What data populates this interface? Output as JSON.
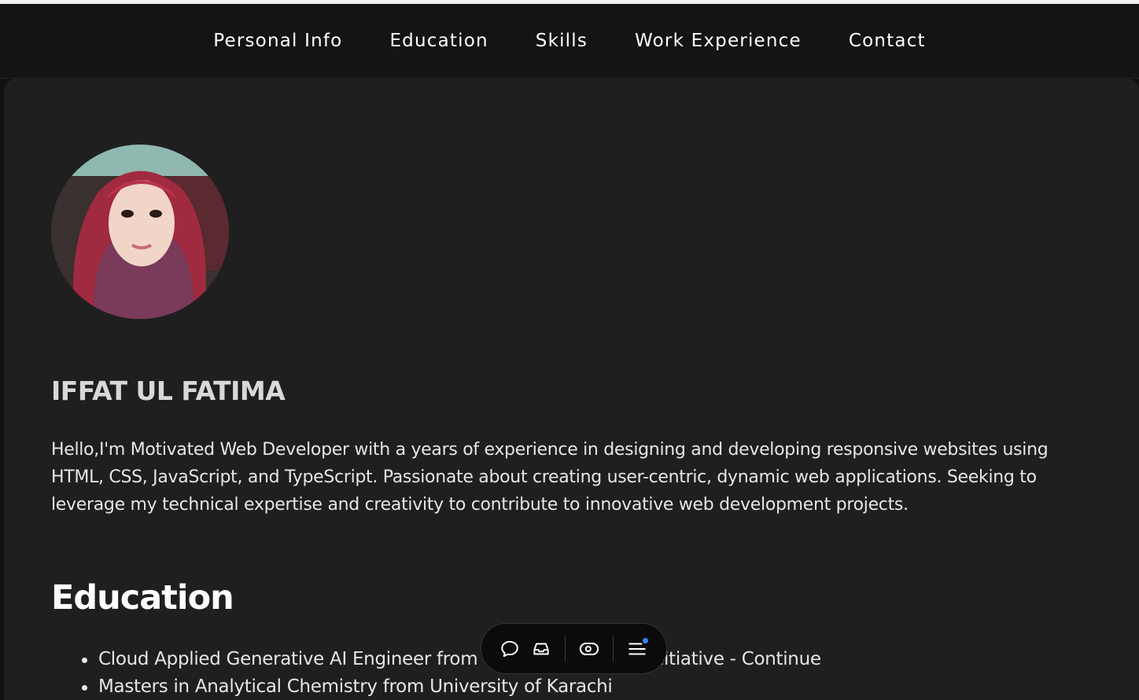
{
  "nav": {
    "items": [
      {
        "label": "Personal Info"
      },
      {
        "label": "Education"
      },
      {
        "label": "Skills"
      },
      {
        "label": "Work Experience"
      },
      {
        "label": "Contact"
      }
    ]
  },
  "profile": {
    "name": "IFFAT UL FATIMA",
    "bio": "Hello,I'm Motivated Web Developer with a years of experience in designing and developing responsive websites using HTML, CSS, JavaScript, and TypeScript. Passionate about creating user-centric, dynamic web applications. Seeking to leverage my technical expertise and creativity to contribute to innovative web development projects."
  },
  "education": {
    "title": "Education",
    "items": [
      {
        "text": "Cloud Applied Generative AI Engineer from Governor Sindh IT Initiative - Continue"
      },
      {
        "text": "Masters in Analytical Chemistry from University of Karachi"
      }
    ]
  },
  "toolbar": {
    "icons": [
      "comment-icon",
      "inbox-icon",
      "eye-icon",
      "menu-icon"
    ],
    "notification_color": "#3b82f6"
  },
  "colors": {
    "page_background": "#121212",
    "card_background": "#1f1f1f",
    "navbar_background": "#141414"
  }
}
